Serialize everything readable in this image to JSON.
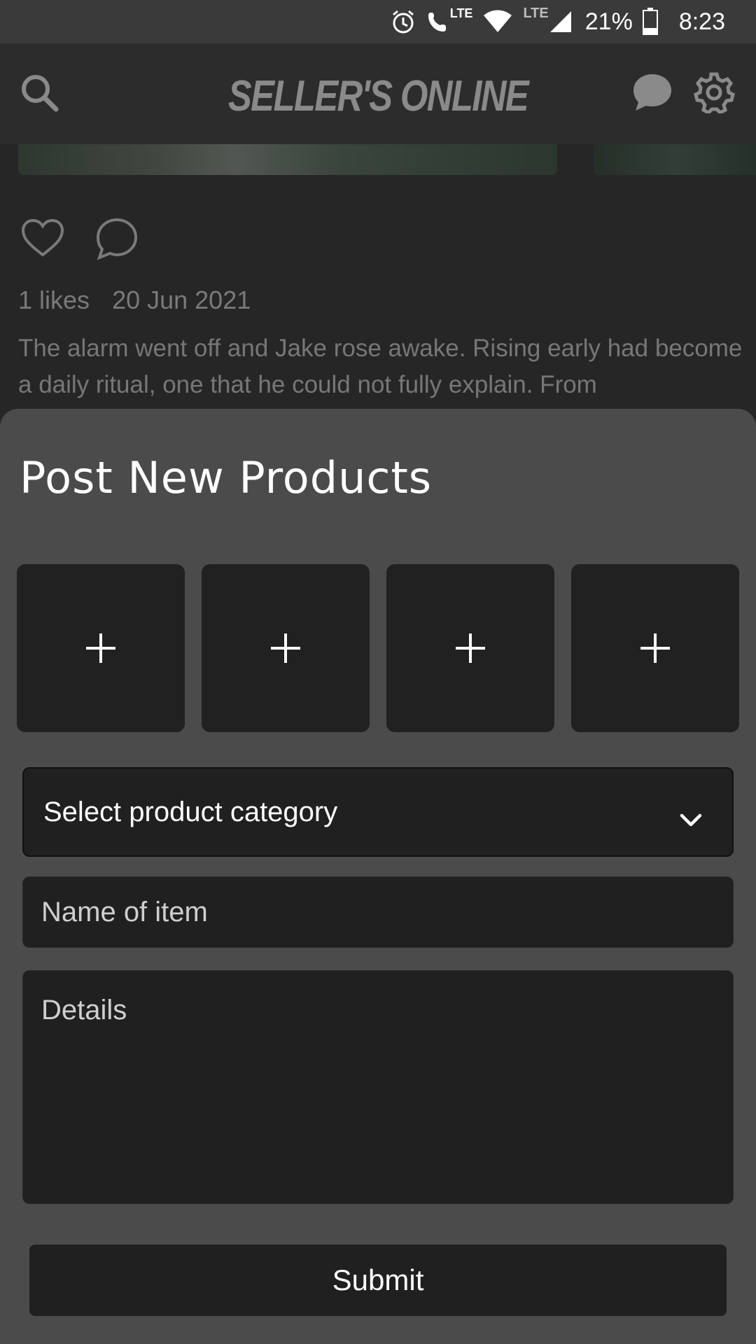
{
  "status_bar": {
    "lte_call": "LTE",
    "lte_signal": "LTE",
    "battery": "21%",
    "time": "8:23"
  },
  "header": {
    "brand": "SELLER'S ONLINE",
    "icons": [
      "search-icon",
      "chat-icon",
      "gear-icon"
    ]
  },
  "post": {
    "likes": "1 likes",
    "date": "20 Jun 2021",
    "caption": "The alarm went off and Jake rose awake. Rising early had become a daily ritual, one that he could not fully explain. From"
  },
  "sheet": {
    "title": "Post New Products",
    "image_slots": [
      "+",
      "+",
      "+",
      "+"
    ],
    "category_select": "Select product category",
    "name_placeholder": "Name of item",
    "details_placeholder": "Details",
    "submit_label": "Submit"
  },
  "colors": {
    "sheet_bg": "#4b4b4b",
    "field_bg": "#202020",
    "header_bg": "#2c2c2c"
  }
}
